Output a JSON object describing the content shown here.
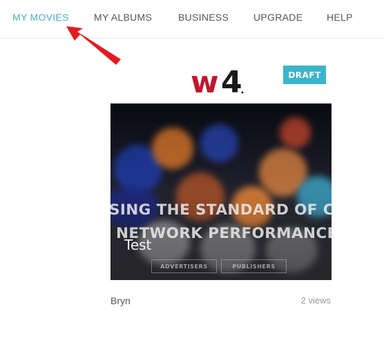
{
  "nav": {
    "items": [
      {
        "label": "MY MOVIES"
      },
      {
        "label": "MY ALBUMS"
      },
      {
        "label": "BUSINESS"
      },
      {
        "label": "UPGRADE"
      },
      {
        "label": "HELP"
      }
    ],
    "active_index": 0,
    "active_color": "#4aaecb"
  },
  "card": {
    "logo_text": "w4",
    "badge": "DRAFT",
    "badge_color": "#3bb5cc",
    "thumbnail": {
      "headline_line1": "SING THE STANDARD OF C",
      "headline_line2": "NETWORK PERFORMANCE",
      "title": "Test",
      "buttons": [
        "ADVERTISERS",
        "PUBLISHERS"
      ]
    },
    "author": "Bryn",
    "views": "2 views"
  },
  "annotation": {
    "arrow_color": "#e8191e"
  }
}
